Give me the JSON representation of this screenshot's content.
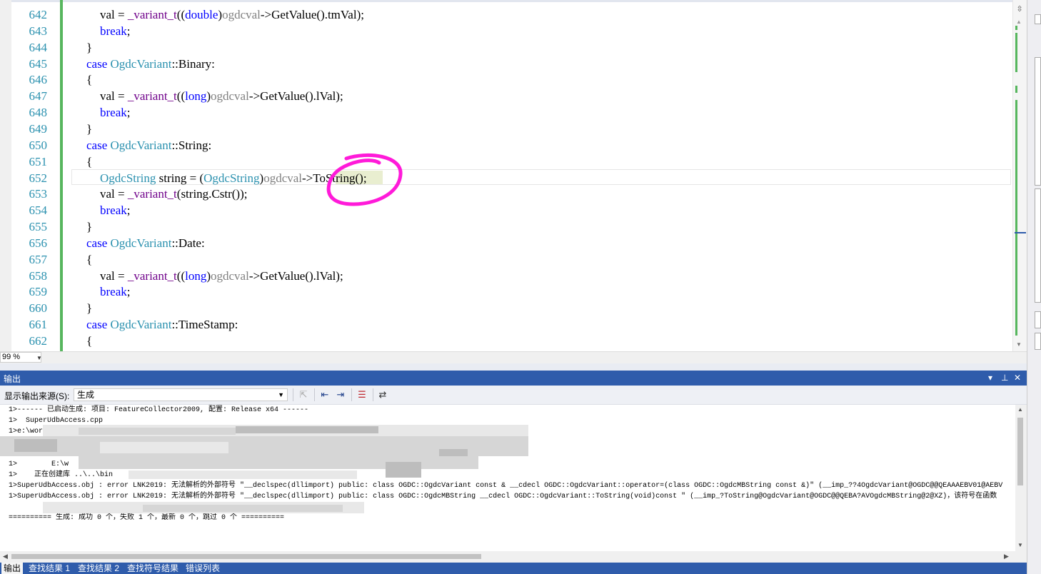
{
  "editor": {
    "lines": [
      {
        "n": "642",
        "indent": 2,
        "tokens": [
          [
            "fn",
            "val = "
          ],
          [
            "mac",
            "_variant_t"
          ],
          [
            "fn",
            "(("
          ],
          [
            "kw",
            "double"
          ],
          [
            "fn",
            ")"
          ],
          [
            "var",
            "ogdcval"
          ],
          [
            "fn",
            "->GetValue().tmVal);"
          ]
        ]
      },
      {
        "n": "643",
        "indent": 2,
        "tokens": [
          [
            "kw",
            "break"
          ],
          [
            "fn",
            ";"
          ]
        ]
      },
      {
        "n": "644",
        "indent": 1,
        "tokens": [
          [
            "fn",
            "}"
          ]
        ]
      },
      {
        "n": "645",
        "indent": 1,
        "tokens": [
          [
            "kw",
            "case "
          ],
          [
            "ty",
            "OgdcVariant"
          ],
          [
            "fn",
            "::Binary:"
          ]
        ]
      },
      {
        "n": "646",
        "indent": 1,
        "tokens": [
          [
            "fn",
            "{"
          ]
        ]
      },
      {
        "n": "647",
        "indent": 2,
        "tokens": [
          [
            "fn",
            "val = "
          ],
          [
            "mac",
            "_variant_t"
          ],
          [
            "fn",
            "(("
          ],
          [
            "kw",
            "long"
          ],
          [
            "fn",
            ")"
          ],
          [
            "var",
            "ogdcval"
          ],
          [
            "fn",
            "->GetValue().lVal);"
          ]
        ]
      },
      {
        "n": "648",
        "indent": 2,
        "tokens": [
          [
            "kw",
            "break"
          ],
          [
            "fn",
            ";"
          ]
        ]
      },
      {
        "n": "649",
        "indent": 1,
        "tokens": [
          [
            "fn",
            "}"
          ]
        ]
      },
      {
        "n": "650",
        "indent": 1,
        "tokens": [
          [
            "kw",
            "case "
          ],
          [
            "ty",
            "OgdcVariant"
          ],
          [
            "fn",
            "::String:"
          ]
        ]
      },
      {
        "n": "651",
        "indent": 1,
        "tokens": [
          [
            "fn",
            "{"
          ]
        ]
      },
      {
        "n": "652",
        "indent": 2,
        "tokens": [
          [
            "ty",
            "OgdcString"
          ],
          [
            "fn",
            " string = ("
          ],
          [
            "ty",
            "OgdcString"
          ],
          [
            "fn",
            ")"
          ],
          [
            "var",
            "ogdcval"
          ],
          [
            "fn",
            "->ToString();"
          ]
        ]
      },
      {
        "n": "653",
        "indent": 2,
        "tokens": [
          [
            "fn",
            "val = "
          ],
          [
            "mac",
            "_variant_t"
          ],
          [
            "fn",
            "(string.Cstr());"
          ]
        ]
      },
      {
        "n": "654",
        "indent": 2,
        "tokens": [
          [
            "kw",
            "break"
          ],
          [
            "fn",
            ";"
          ]
        ]
      },
      {
        "n": "655",
        "indent": 1,
        "tokens": [
          [
            "fn",
            "}"
          ]
        ]
      },
      {
        "n": "656",
        "indent": 1,
        "tokens": [
          [
            "kw",
            "case "
          ],
          [
            "ty",
            "OgdcVariant"
          ],
          [
            "fn",
            "::Date:"
          ]
        ]
      },
      {
        "n": "657",
        "indent": 1,
        "tokens": [
          [
            "fn",
            "{"
          ]
        ]
      },
      {
        "n": "658",
        "indent": 2,
        "tokens": [
          [
            "fn",
            "val = "
          ],
          [
            "mac",
            "_variant_t"
          ],
          [
            "fn",
            "(("
          ],
          [
            "kw",
            "long"
          ],
          [
            "fn",
            ")"
          ],
          [
            "var",
            "ogdcval"
          ],
          [
            "fn",
            "->GetValue().lVal);"
          ]
        ]
      },
      {
        "n": "659",
        "indent": 2,
        "tokens": [
          [
            "kw",
            "break"
          ],
          [
            "fn",
            ";"
          ]
        ]
      },
      {
        "n": "660",
        "indent": 1,
        "tokens": [
          [
            "fn",
            "}"
          ]
        ]
      },
      {
        "n": "661",
        "indent": 1,
        "tokens": [
          [
            "kw",
            "case "
          ],
          [
            "ty",
            "OgdcVariant"
          ],
          [
            "fn",
            "::TimeStamp:"
          ]
        ]
      },
      {
        "n": "662",
        "indent": 1,
        "tokens": [
          [
            "fn",
            "{"
          ]
        ]
      }
    ],
    "zoom": "99 %"
  },
  "output": {
    "title": "输出",
    "source_label": "显示输出来源(S):",
    "source_value": "生成",
    "lines": [
      "1>------ 已启动生成: 项目: FeatureCollector2009, 配置: Release x64 ------",
      "1>  SuperUdbAccess.cpp",
      "1>e:\\work\\",
      "",
      "",
      "1>        E:\\w",
      "1>    正在创建库 ..\\..\\bin",
      "1>SuperUdbAccess.obj : error LNK2019: 无法解析的外部符号 \"__declspec(dllimport) public: class OGDC::OgdcVariant const & __cdecl OGDC::OgdcVariant::operator=(class OGDC::OgdcMBString const &)\" (__imp_??4OgdcVariant@OGDC@@QEAAAEBV01@AEBV",
      "1>SuperUdbAccess.obj : error LNK2019: 无法解析的外部符号 \"__declspec(dllimport) public: class OGDC::OgdcMBString __cdecl OGDC::OgdcVariant::ToString(void)const \" (__imp_?ToString@OgdcVariant@OGDC@@QEBA?AVOgdcMBString@2@XZ)，该符号在函数",
      "",
      "========== 生成: 成功 0 个，失败 1 个，最新 0 个，跳过 0 个 =========="
    ]
  },
  "bottom_tabs": [
    "输出",
    "查找结果 1",
    "查找结果 2",
    "查找符号结果",
    "错误列表"
  ],
  "colors": {
    "keyword": "#0000ff",
    "type": "#2b91af",
    "macro": "#6f008a",
    "variable": "#808080",
    "change_bar": "#57b65e",
    "panel_title": "#2f5cab",
    "annotation": "#ff1ad9"
  },
  "icons": [
    "split-icon",
    "collapse-icon",
    "scroll-up-icon",
    "scroll-down-icon",
    "find-message-icon",
    "go-prev-icon",
    "go-next-icon",
    "clear-all-icon",
    "word-wrap-icon",
    "dropdown-icon",
    "pin-icon",
    "close-icon"
  ]
}
